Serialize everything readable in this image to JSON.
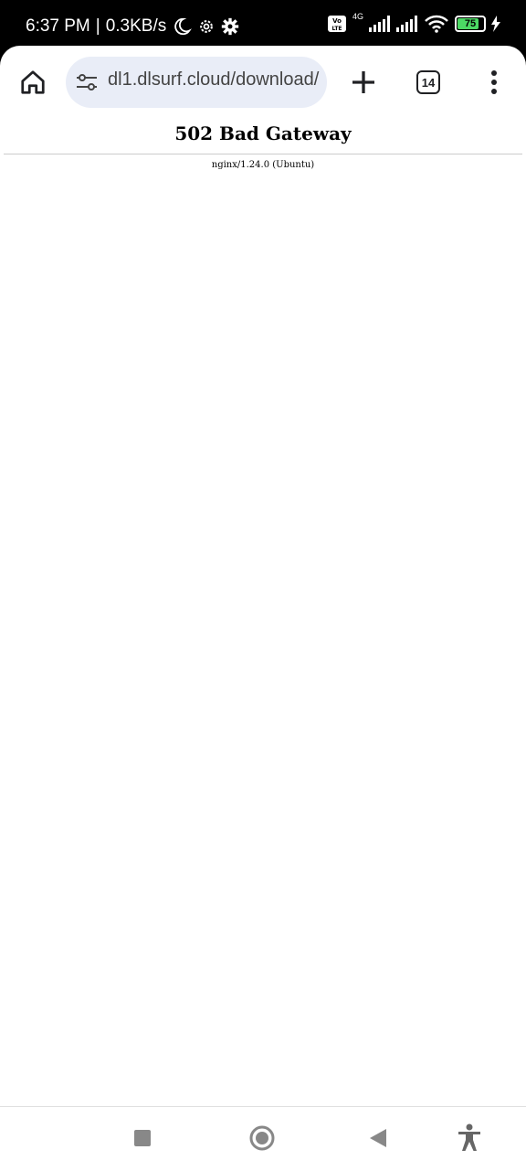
{
  "status_bar": {
    "time": "6:37 PM",
    "speed": "0.3KB/s",
    "separator": "|",
    "network": "4G",
    "volte": "Vo LTE",
    "battery": "75",
    "icons": [
      "moon-icon",
      "settings-outline-icon",
      "gear-icon",
      "volte-icon",
      "signal-icon",
      "signal-icon",
      "wifi-icon",
      "battery-icon",
      "charging-icon"
    ]
  },
  "toolbar": {
    "url": "dl1.dlsurf.cloud/download/",
    "tab_count": "14",
    "icons": [
      "home-icon",
      "tune-icon",
      "plus-icon",
      "tabs-icon",
      "more-vert-icon"
    ]
  },
  "page": {
    "title": "502 Bad Gateway",
    "server": "nginx/1.24.0 (Ubuntu)"
  },
  "nav": {
    "icons": [
      "recents-icon",
      "home-circle-icon",
      "back-icon",
      "accessibility-icon"
    ]
  }
}
